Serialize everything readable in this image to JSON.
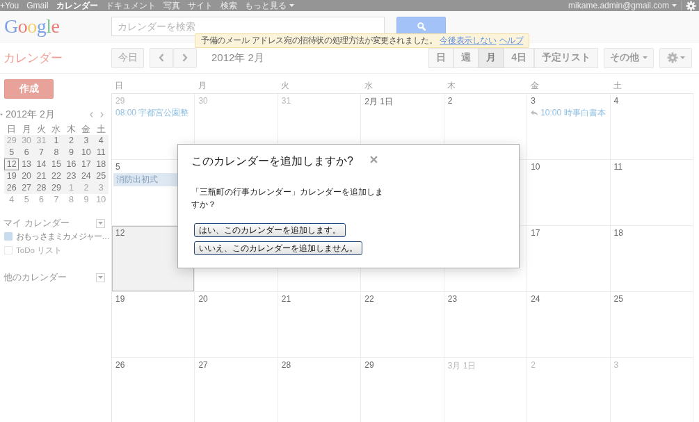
{
  "top_bar": {
    "links": [
      {
        "label": "+You",
        "selected": false
      },
      {
        "label": "Gmail",
        "selected": false
      },
      {
        "label": "カレンダー",
        "selected": true
      },
      {
        "label": "ドキュメント",
        "selected": false
      },
      {
        "label": "写真",
        "selected": false
      },
      {
        "label": "サイト",
        "selected": false
      },
      {
        "label": "検索",
        "selected": false
      },
      {
        "label": "もっと見る",
        "selected": false,
        "menu": true
      }
    ],
    "account": "mikame.admin@gmail.com"
  },
  "header": {
    "logo": "Google",
    "search": {
      "placeholder": "カレンダーを検索"
    }
  },
  "notice": {
    "text": "予備のメール アドレス宛の招待状の処理方法が変更されました。",
    "links": [
      "今後表示しない",
      "ヘルプ"
    ]
  },
  "app_title": "カレンダー",
  "toolbar": {
    "today": "今日",
    "period": "2012年 2月",
    "views": [
      {
        "label": "日",
        "selected": false
      },
      {
        "label": "週",
        "selected": false
      },
      {
        "label": "月",
        "selected": true
      },
      {
        "label": "4日",
        "selected": false
      },
      {
        "label": "予定リスト",
        "selected": false
      }
    ],
    "more": "その他"
  },
  "sidebar": {
    "create": "作成",
    "mini_calendar": {
      "title": "2012年 2月",
      "weekdays": [
        "日",
        "月",
        "火",
        "水",
        "木",
        "金",
        "土"
      ],
      "weeks": [
        {
          "in_view": true,
          "days": [
            {
              "day": "29",
              "in_month": false,
              "today": false
            },
            {
              "day": "30",
              "in_month": false,
              "today": false
            },
            {
              "day": "31",
              "in_month": false,
              "today": false
            },
            {
              "day": "1",
              "in_month": true,
              "today": false
            },
            {
              "day": "2",
              "in_month": true,
              "today": false
            },
            {
              "day": "3",
              "in_month": true,
              "today": false
            },
            {
              "day": "4",
              "in_month": true,
              "today": false
            }
          ]
        },
        {
          "in_view": true,
          "days": [
            {
              "day": "5",
              "in_month": true,
              "today": false
            },
            {
              "day": "6",
              "in_month": true,
              "today": false
            },
            {
              "day": "7",
              "in_month": true,
              "today": false
            },
            {
              "day": "8",
              "in_month": true,
              "today": false
            },
            {
              "day": "9",
              "in_month": true,
              "today": false
            },
            {
              "day": "10",
              "in_month": true,
              "today": false
            },
            {
              "day": "11",
              "in_month": true,
              "today": false
            }
          ]
        },
        {
          "in_view": true,
          "days": [
            {
              "day": "12",
              "in_month": true,
              "today": true
            },
            {
              "day": "13",
              "in_month": true,
              "today": false
            },
            {
              "day": "14",
              "in_month": true,
              "today": false
            },
            {
              "day": "15",
              "in_month": true,
              "today": false
            },
            {
              "day": "16",
              "in_month": true,
              "today": false
            },
            {
              "day": "17",
              "in_month": true,
              "today": false
            },
            {
              "day": "18",
              "in_month": true,
              "today": false
            }
          ]
        },
        {
          "in_view": true,
          "days": [
            {
              "day": "19",
              "in_month": true,
              "today": false
            },
            {
              "day": "20",
              "in_month": true,
              "today": false
            },
            {
              "day": "21",
              "in_month": true,
              "today": false
            },
            {
              "day": "22",
              "in_month": true,
              "today": false
            },
            {
              "day": "23",
              "in_month": true,
              "today": false
            },
            {
              "day": "24",
              "in_month": true,
              "today": false
            },
            {
              "day": "25",
              "in_month": true,
              "today": false
            }
          ]
        },
        {
          "in_view": true,
          "days": [
            {
              "day": "26",
              "in_month": true,
              "today": false
            },
            {
              "day": "27",
              "in_month": true,
              "today": false
            },
            {
              "day": "28",
              "in_month": true,
              "today": false
            },
            {
              "day": "29",
              "in_month": true,
              "today": false
            },
            {
              "day": "1",
              "in_month": false,
              "today": false
            },
            {
              "day": "2",
              "in_month": false,
              "today": false
            },
            {
              "day": "3",
              "in_month": false,
              "today": false
            }
          ]
        },
        {
          "in_view": false,
          "days": [
            {
              "day": "4",
              "in_month": false,
              "today": false
            },
            {
              "day": "5",
              "in_month": false,
              "today": false
            },
            {
              "day": "6",
              "in_month": false,
              "today": false
            },
            {
              "day": "7",
              "in_month": false,
              "today": false
            },
            {
              "day": "8",
              "in_month": false,
              "today": false
            },
            {
              "day": "9",
              "in_month": false,
              "today": false
            },
            {
              "day": "10",
              "in_month": false,
              "today": false
            }
          ]
        }
      ]
    },
    "my_calendars": {
      "title": "マイ カレンダー",
      "items": [
        {
          "name": "おもっさまミカメジャー…",
          "checked": true,
          "color": "#c8dcf0"
        },
        {
          "name": "ToDo リスト",
          "checked": false
        }
      ]
    },
    "other_calendars": {
      "title": "他のカレンダー"
    }
  },
  "month": {
    "weekdays": [
      "日",
      "月",
      "火",
      "水",
      "木",
      "金",
      "土"
    ],
    "weeks": [
      {
        "cells": [
          {
            "date": "29",
            "in_month": false,
            "today": false,
            "events": [
              {
                "kind": "timed",
                "text": "08:00 宇都宮公園整"
              }
            ]
          },
          {
            "date": "30",
            "in_month": false,
            "today": false
          },
          {
            "date": "31",
            "in_month": false,
            "today": false
          },
          {
            "date": "2月 1日",
            "in_month": true,
            "today": false
          },
          {
            "date": "2",
            "in_month": true,
            "today": false
          },
          {
            "date": "3",
            "in_month": true,
            "today": false,
            "events": [
              {
                "kind": "timed",
                "arrow": true,
                "text": "10:00 時事白書本"
              }
            ]
          },
          {
            "date": "4",
            "in_month": true,
            "today": false
          }
        ]
      },
      {
        "cells": [
          {
            "date": "5",
            "in_month": true,
            "today": false,
            "events": [
              {
                "kind": "all_day",
                "text": "消防出初式"
              }
            ]
          },
          {},
          {},
          {},
          {
            "today": false
          },
          {
            "date": "10",
            "in_month": true,
            "today": false
          },
          {
            "date": "11",
            "in_month": true,
            "today": false
          }
        ]
      },
      {
        "cells": [
          {
            "date": "12",
            "in_month": true,
            "today": true
          },
          {
            "today": false
          },
          {
            "today": false
          },
          {
            "today": false
          },
          {
            "today": false
          },
          {
            "date": "17",
            "in_month": true,
            "today": false
          },
          {
            "date": "18",
            "in_month": true,
            "today": false
          }
        ]
      },
      {
        "cells": [
          {
            "date": "19",
            "in_month": true,
            "today": false
          },
          {
            "date": "20",
            "in_month": true,
            "today": false
          },
          {
            "date": "21",
            "in_month": true,
            "today": false
          },
          {
            "date": "22",
            "in_month": true,
            "today": false
          },
          {
            "date": "23",
            "in_month": true,
            "today": false
          },
          {
            "date": "24",
            "in_month": true,
            "today": false
          },
          {
            "date": "25",
            "in_month": true,
            "today": false
          }
        ]
      },
      {
        "cells": [
          {
            "date": "26",
            "in_month": true,
            "today": false
          },
          {
            "date": "27",
            "in_month": true,
            "today": false
          },
          {
            "date": "28",
            "in_month": true,
            "today": false
          },
          {
            "date": "29",
            "in_month": true,
            "today": false
          },
          {
            "date": "3月 1日",
            "in_month": false,
            "today": false
          },
          {
            "date": "2",
            "in_month": false,
            "today": false
          },
          {
            "date": "3",
            "in_month": false,
            "today": false
          }
        ]
      }
    ]
  },
  "dialog": {
    "title": "このカレンダーを追加しますか?",
    "message": "「三瓶町の行事カレンダー」カレンダーを追加しますか？",
    "buttons": [
      "はい、このカレンダーを追加します。",
      "いいえ、このカレンダーを追加しません。"
    ]
  }
}
